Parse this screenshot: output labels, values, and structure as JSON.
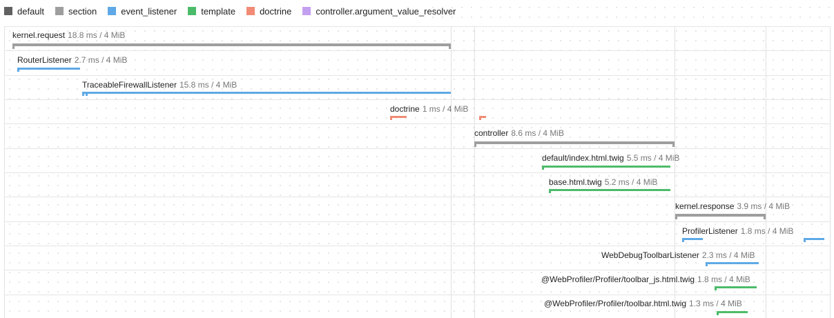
{
  "legend": [
    {
      "key": "default",
      "label": "default",
      "color": "#616161"
    },
    {
      "key": "section",
      "label": "section",
      "color": "#9e9e9e"
    },
    {
      "key": "event_listener",
      "label": "event_listener",
      "color": "#5ea9e6"
    },
    {
      "key": "template",
      "label": "template",
      "color": "#4cbb69"
    },
    {
      "key": "doctrine",
      "label": "doctrine",
      "color": "#f18b75"
    },
    {
      "key": "controller",
      "label": "controller.argument_value_resolver",
      "color": "#c39ff0"
    }
  ],
  "events": [
    {
      "name": "kernel.request",
      "duration": "18.8 ms / 4 MiB",
      "category": "section"
    },
    {
      "name": "RouterListener",
      "duration": "2.7 ms / 4 MiB",
      "category": "event_listener"
    },
    {
      "name": "TraceableFirewallListener",
      "duration": "15.8 ms / 4 MiB",
      "category": "event_listener"
    },
    {
      "name": "doctrine",
      "duration": "1 ms / 4 MiB",
      "category": "doctrine"
    },
    {
      "name": "controller",
      "duration": "8.6 ms / 4 MiB",
      "category": "section"
    },
    {
      "name": "default/index.html.twig",
      "duration": "5.5 ms / 4 MiB",
      "category": "template"
    },
    {
      "name": "base.html.twig",
      "duration": "5.2 ms / 4 MiB",
      "category": "template"
    },
    {
      "name": "kernel.response",
      "duration": "3.9 ms / 4 MiB",
      "category": "section"
    },
    {
      "name": "ProfilerListener",
      "duration": "1.8 ms / 4 MiB",
      "category": "event_listener"
    },
    {
      "name": "WebDebugToolbarListener",
      "duration": "2.3 ms / 4 MiB",
      "category": "event_listener"
    },
    {
      "name": "@WebProfiler/Profiler/toolbar_js.html.twig",
      "duration": "1.8 ms / 4 MiB",
      "category": "template"
    },
    {
      "name": "@WebProfiler/Profiler/toolbar.html.twig",
      "duration": "1.3 ms / 4 MiB",
      "category": "template"
    }
  ]
}
